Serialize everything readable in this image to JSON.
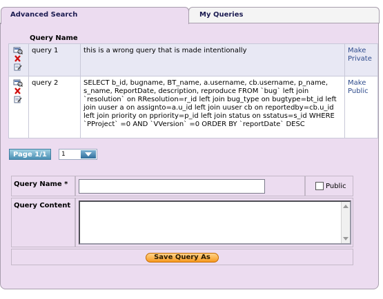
{
  "tabs": [
    {
      "label": "Advanced Search",
      "active": true
    },
    {
      "label": "My Queries",
      "active": false
    }
  ],
  "queries": {
    "header": "Query Name",
    "rows": [
      {
        "name": "query 1",
        "content": "this is a wrong query that is made intentionally",
        "action": "Make Private"
      },
      {
        "name": "query 2",
        "content": "SELECT b_id, bugname, BT_name, a.username, cb.username, p_name, s_name, ReportDate, description, reproduce FROM `bug` left join `resolution` on RResolution=r_id left join bug_type on bugtype=bt_id left join uuser a on assignto=a.u_id left join uuser cb on reportedby=cb.u_id left join priority on ppriority=p_id left join status on sstatus=s_id WHERE `PProject` =0 AND `VVersion` =0 ORDER BY `reportDate` DESC",
        "action": "Make Public"
      }
    ],
    "row_icons": [
      "view-icon",
      "delete-icon",
      "edit-icon"
    ]
  },
  "pager": {
    "label": "Page 1/1",
    "current": "1"
  },
  "form": {
    "name_label": "Query Name *",
    "name_value": "",
    "public_label": "Public",
    "public_checked": false,
    "content_label": "Query Content",
    "content_value": "",
    "save_label": "Save Query As"
  },
  "colors": {
    "panel": "#ecdcf0",
    "link": "#2e4b8c",
    "button": "#f79a21",
    "pager": "#4a8fb3"
  }
}
